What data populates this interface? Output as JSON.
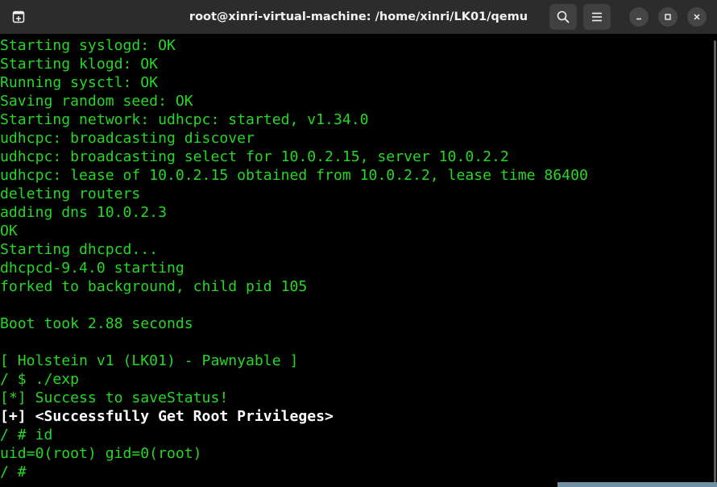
{
  "window": {
    "title": "root@xinri-virtual-machine: /home/xinri/LK01/qemu"
  },
  "titlebar": {
    "newtab_icon": "new-tab-icon",
    "search_icon": "search-icon",
    "menu_icon": "hamburger-menu-icon",
    "minimize_icon": "minimize-icon",
    "maximize_icon": "maximize-icon",
    "close_icon": "close-icon"
  },
  "colors": {
    "terminal_background": "#000000",
    "terminal_green": "#26d726",
    "terminal_white": "#ffffff",
    "titlebar_background": "#2c2c2c"
  },
  "terminal": {
    "lines": [
      "Starting syslogd: OK",
      "Starting klogd: OK",
      "Running sysctl: OK",
      "Saving random seed: OK",
      "Starting network: udhcpc: started, v1.34.0",
      "udhcpc: broadcasting discover",
      "udhcpc: broadcasting select for 10.0.2.15, server 10.0.2.2",
      "udhcpc: lease of 10.0.2.15 obtained from 10.0.2.2, lease time 86400",
      "deleting routers",
      "adding dns 10.0.2.3",
      "OK",
      "Starting dhcpcd...",
      "dhcpcd-9.4.0 starting",
      "forked to background, child pid 105",
      "",
      "Boot took 2.88 seconds",
      "",
      "[ Holstein v1 (LK01) - Pawnyable ]",
      "/ $ ./exp",
      "[*] Success to saveStatus!",
      "[+] <Successfully Get Root Privileges>",
      "/ # id",
      "uid=0(root) gid=0(root)",
      "/ #"
    ]
  }
}
